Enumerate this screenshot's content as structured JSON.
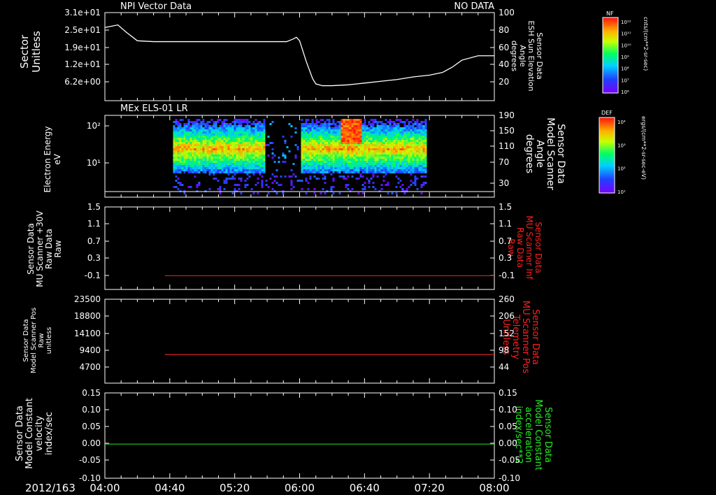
{
  "chart_data": [
    {
      "type": "line",
      "title": "NPI Vector Data",
      "status": "NO DATA",
      "ylabel": [
        "Sector",
        "Unitless"
      ],
      "yticks_left": [
        "3.1e+01",
        "2.5e+01",
        "1.9e+01",
        "1.2e+01",
        "6.2e+00"
      ],
      "ylabel_right": [
        "Sensor Data",
        "ESH Sun Elevation",
        "Angle",
        "degrees"
      ],
      "yticks_right": [
        "100",
        "80",
        "60",
        "40",
        "20"
      ],
      "ylim_right": [
        0,
        100
      ],
      "series": [
        {
          "color": "#ffffff",
          "x": [
            "04:00",
            "04:08",
            "04:13",
            "04:20",
            "04:30",
            "04:45",
            "05:00",
            "05:20",
            "05:40",
            "05:52",
            "05:56",
            "05:58",
            "06:00",
            "06:04",
            "06:08",
            "06:10",
            "06:14",
            "06:20",
            "06:30",
            "06:40",
            "06:50",
            "07:00",
            "07:10",
            "07:20",
            "07:28",
            "07:34",
            "07:40",
            "07:50",
            "08:00"
          ],
          "y": [
            83,
            86,
            78,
            68,
            67,
            67,
            67,
            67,
            67,
            67,
            70,
            72,
            68,
            45,
            25,
            19,
            17,
            17,
            18,
            20,
            22,
            24,
            27,
            29,
            32,
            38,
            46,
            51,
            51
          ]
        }
      ]
    },
    {
      "type": "heatmap",
      "title": "MEx ELS-01 LR",
      "ylabel": [
        "Electron Energy",
        "eV"
      ],
      "yticks_left": [
        "10²",
        "10¹"
      ],
      "ylabel_right": [
        "Sensor Data",
        "Model Scanner",
        "Angle",
        "degrees"
      ],
      "yticks_right": [
        "190",
        "150",
        "110",
        "70",
        "30"
      ],
      "ylim_right": [
        0,
        190
      ],
      "data_span": [
        "04:42",
        "07:18"
      ],
      "reference_line_y": 2
    },
    {
      "type": "line",
      "ylabel": [
        "Sensor Data",
        "MU Scanner +30V",
        "Raw Data",
        "Raw"
      ],
      "yticks_left": [
        "1.5",
        "1.1",
        "0.7",
        "0.3",
        "-0.1"
      ],
      "ylim": [
        -0.3,
        1.5
      ],
      "ylabel_right": [
        "Sensor Data",
        "MU Scanner Inf",
        "Raw Data",
        "Raw"
      ],
      "yticks_right": [
        "1.5",
        "1.1",
        "0.7",
        "0.3",
        "-0.1"
      ],
      "series": [
        {
          "color": "#dd2222",
          "x": [
            "04:37",
            "08:00"
          ],
          "y": [
            0.0,
            0.0
          ]
        }
      ]
    },
    {
      "type": "line",
      "ylabel": [
        "Sensor Data",
        "Model Scanner Pos",
        "Raw",
        "unitless"
      ],
      "yticks_left": [
        "23500",
        "18800",
        "14100",
        "9400",
        "4700"
      ],
      "ylim": [
        0,
        23500
      ],
      "ylabel_right": [
        "Sensor Data",
        "MU Scanner Pos",
        "Telemetry",
        "Unitless"
      ],
      "yticks_right": [
        "260",
        "206",
        "152",
        "98",
        "44"
      ],
      "series": [
        {
          "color": "#dd2222",
          "x": [
            "04:37",
            "08:00"
          ],
          "y": [
            8000,
            8000
          ]
        }
      ]
    },
    {
      "type": "line",
      "ylabel": [
        "Sensor Data",
        "Model Constant",
        "velocity",
        "index/sec"
      ],
      "yticks_left": [
        "0.15",
        "0.10",
        "0.05",
        "0.00",
        "-0.05",
        "-0.10"
      ],
      "ylim": [
        -0.1,
        0.15
      ],
      "ylabel_right": [
        "Sensor Data",
        "Model Constant",
        "acceleration",
        "index/sec**2"
      ],
      "yticks_right": [
        "0.15",
        "0.10",
        "0.05",
        "0.00",
        "-0.05",
        "-0.10"
      ],
      "series": [
        {
          "color": "#22cc22",
          "x": [
            "04:00",
            "08:00"
          ],
          "y": [
            0.0,
            0.0
          ]
        }
      ]
    }
  ],
  "time_axis": {
    "date_label": "2012/163",
    "ticks": [
      "04:00",
      "04:40",
      "05:20",
      "06:00",
      "06:40",
      "07:20",
      "08:00"
    ]
  },
  "colorbars": [
    {
      "label": "NF",
      "unit": "cnts/(cm**2-sr-sec)",
      "ticks": [
        "10¹²",
        "10¹¹",
        "10¹⁰",
        "10⁹",
        "10⁸",
        "10⁷",
        "10⁶"
      ]
    },
    {
      "label": "DEF",
      "unit": "ergs/(cm**2-sr-sec-eV)",
      "ticks": [
        "10⁴",
        "10³",
        "10²",
        "10¹"
      ]
    }
  ],
  "colors": {
    "axis": "#ffffff",
    "right_label_red": "#ff2020",
    "right_label_green": "#22ee22"
  }
}
